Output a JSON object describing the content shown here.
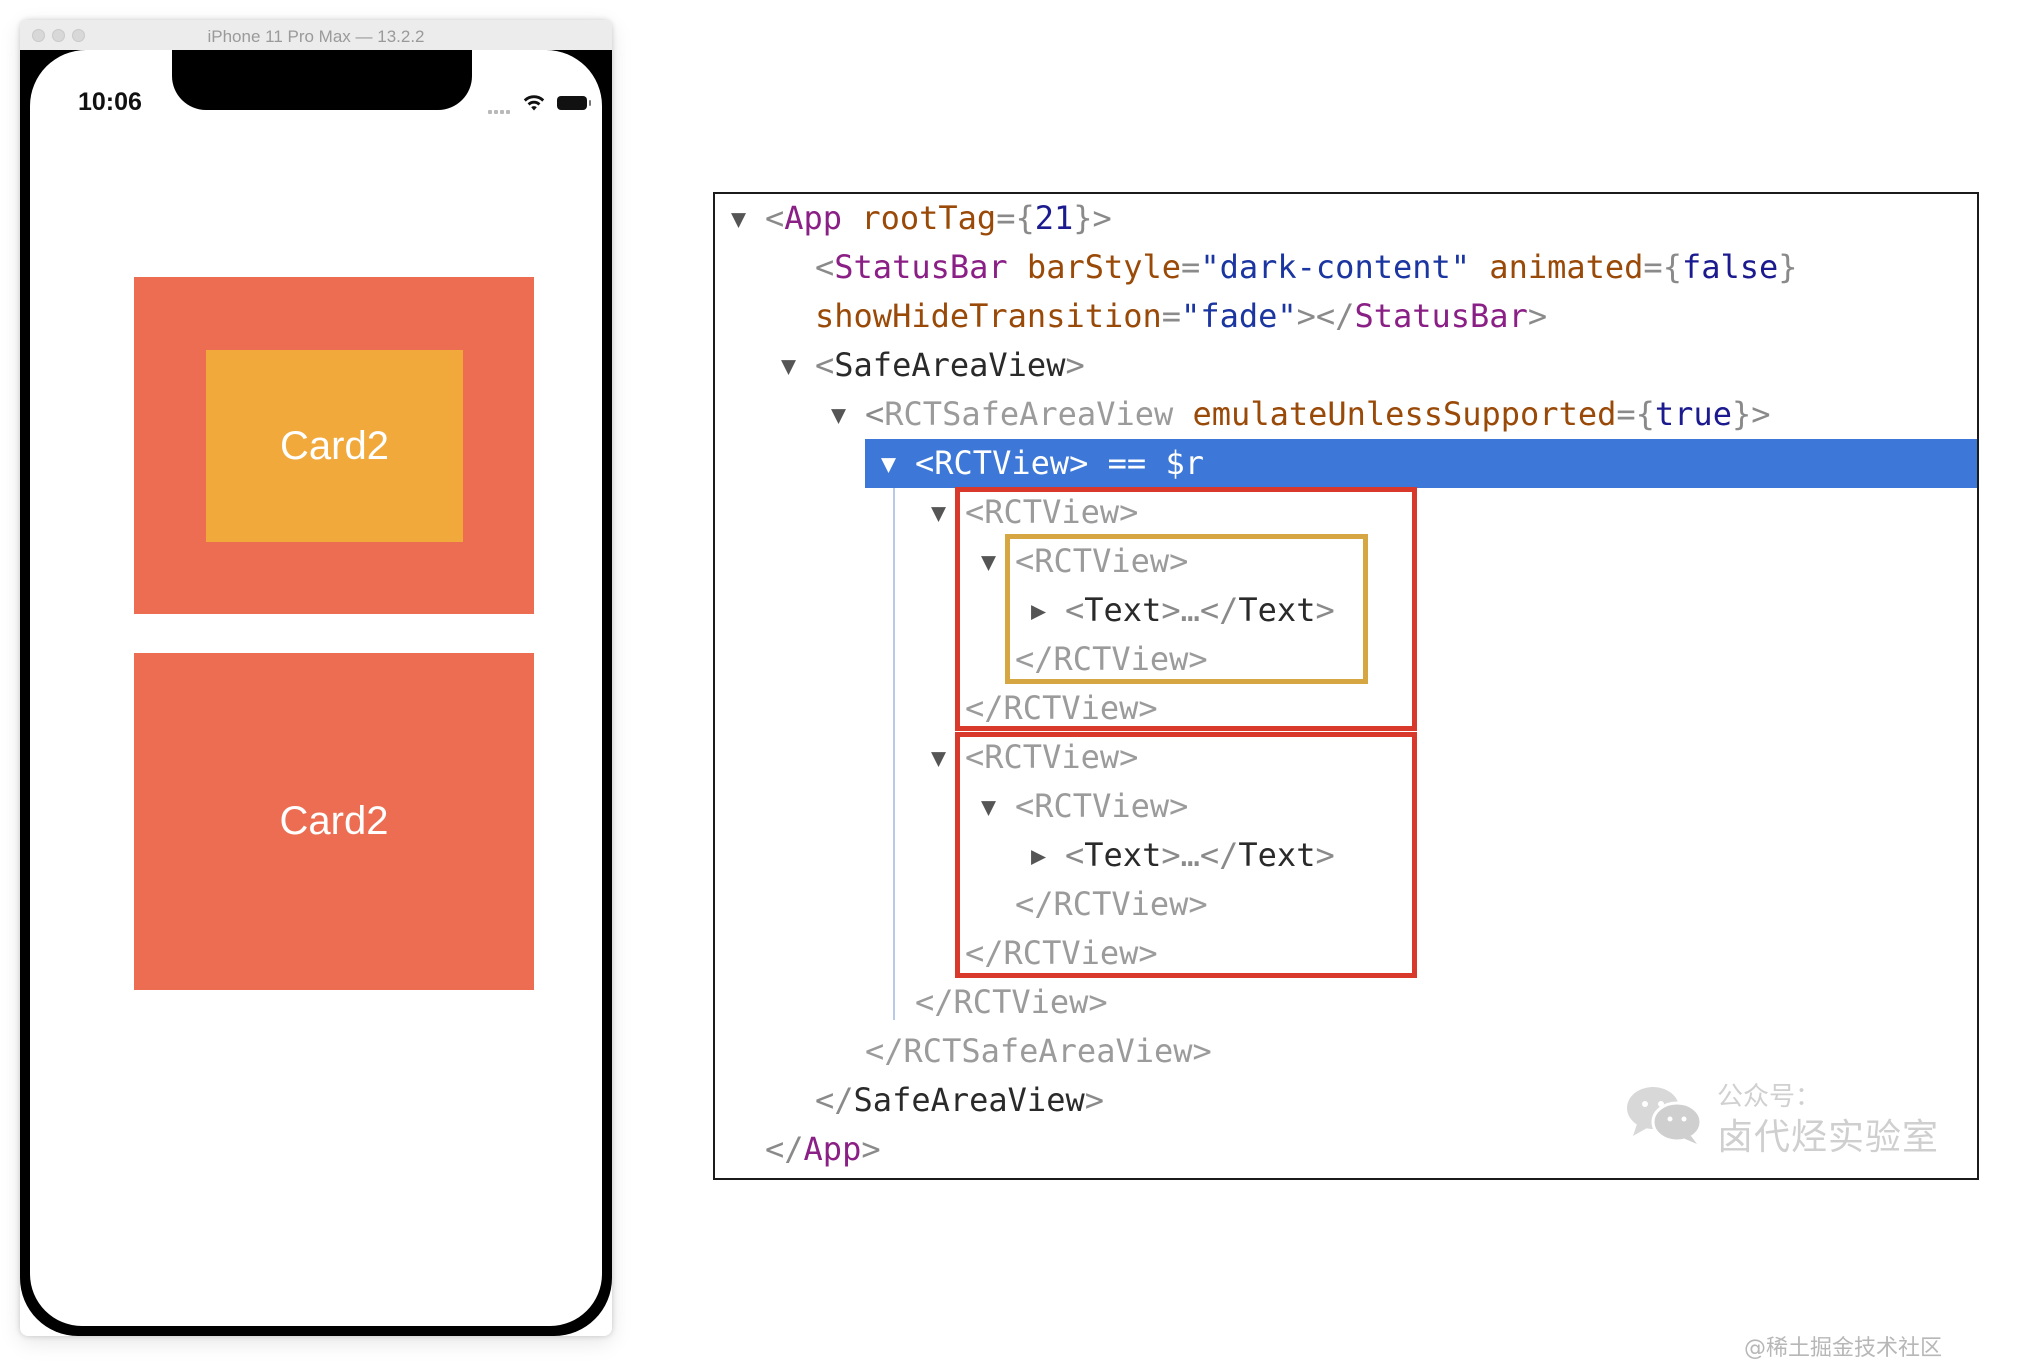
{
  "simulator": {
    "window_title": "iPhone 11 Pro Max — 13.2.2",
    "status_time": "10:06",
    "card1_label": "Card2",
    "card2_label": "Card2",
    "card_color": "#ec6d51",
    "inner_card_color": "#f2a93b"
  },
  "tree": {
    "l1": {
      "toggle": "▼",
      "open": "<",
      "tag": "App",
      "attr": "rootTag",
      "eq": "=",
      "brace_open": "{",
      "value": "21",
      "brace_close": "}",
      "close": ">"
    },
    "l2": {
      "open": "<",
      "tag": "StatusBar",
      "attr1": "barStyle",
      "eq1": "=",
      "value1": "\"dark-content\"",
      "attr2": "animated",
      "eq2": "=",
      "brace_open": "{",
      "value2": "false",
      "brace_close": "}"
    },
    "l3": {
      "attr": "showHideTransition",
      "eq": "=",
      "value": "\"fade\"",
      "mid": "></",
      "tag": "StatusBar",
      "close": ">"
    },
    "l4": {
      "toggle": "▼",
      "open": "<",
      "tag": "SafeAreaView",
      "close": ">"
    },
    "l5": {
      "toggle": "▼",
      "open": "<",
      "tag": "RCTSafeAreaView",
      "attr": "emulateUnlessSupported",
      "eq": "=",
      "brace_open": "{",
      "value": "true",
      "brace_close": "}",
      "close": ">"
    },
    "l6": {
      "toggle": "▼",
      "text": "<RCTView> == $r"
    },
    "l7": {
      "toggle": "▼",
      "text": "<RCTView>"
    },
    "l8": {
      "toggle": "▼",
      "text": "<RCTView>"
    },
    "l9": {
      "toggle": "▶",
      "open": "<",
      "tag1": "Text",
      "mid": ">…</",
      "tag2": "Text",
      "close": ">"
    },
    "l10": {
      "text": "</RCTView>"
    },
    "l11": {
      "text": "</RCTView>"
    },
    "l12": {
      "toggle": "▼",
      "text": "<RCTView>"
    },
    "l13": {
      "toggle": "▼",
      "text": "<RCTView>"
    },
    "l14": {
      "toggle": "▶",
      "open": "<",
      "tag1": "Text",
      "mid": ">…</",
      "tag2": "Text",
      "close": ">"
    },
    "l15": {
      "text": "</RCTView>"
    },
    "l16": {
      "text": "</RCTView>"
    },
    "l17": {
      "text": "</RCTView>"
    },
    "l18": {
      "text": "</RCTSafeAreaView>"
    },
    "l19": {
      "open": "</",
      "tag": "SafeAreaView",
      "close": ">"
    },
    "l20": {
      "open": "</",
      "tag": "App",
      "close": ">"
    },
    "selection_color": "#3d78d8",
    "highlight_red": "#d8392a",
    "highlight_gold": "#d6a642"
  },
  "overlay": {
    "wechat_label": "公众号：",
    "wechat_name": "卤代烃实验室",
    "watermark": "@稀土掘金技术社区"
  }
}
